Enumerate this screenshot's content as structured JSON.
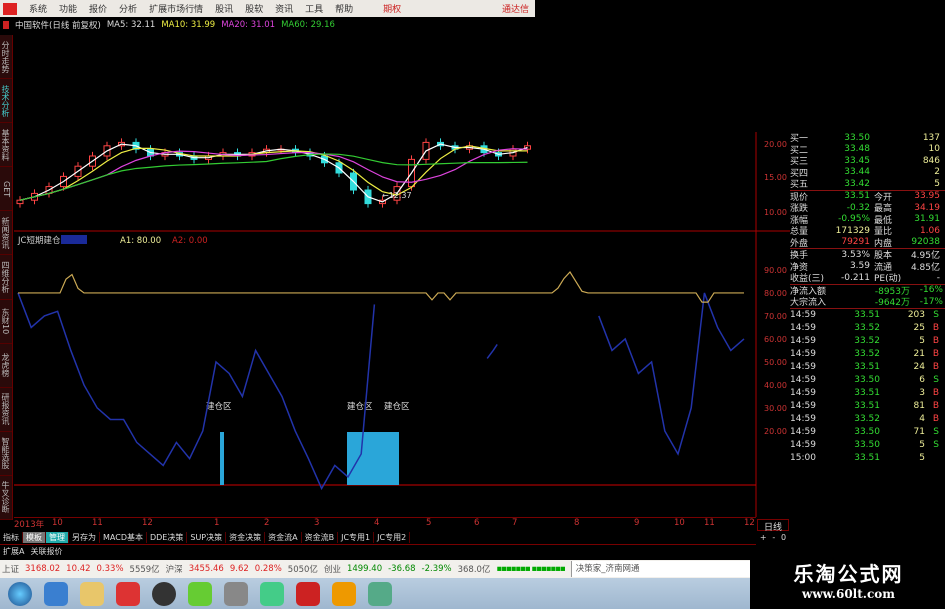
{
  "menu": {
    "items": [
      "系统",
      "功能",
      "报价",
      "分析",
      "扩展市场行情",
      "股讯",
      "股软",
      "资讯",
      "工具",
      "帮助"
    ],
    "option": "期权",
    "brand": "通达信"
  },
  "title": {
    "stock": "中国软件(日线 前复权)",
    "ma5": "MA5: 32.11",
    "ma10": "MA10: 31.99",
    "ma20": "MA20: 31.01",
    "ma60": "MA60: 29.16"
  },
  "left_tabs": [
    "分时走势",
    "技术分析",
    "基本资料",
    "GET",
    "新闻资讯",
    "四维分析",
    "东财10",
    "龙虎榜",
    "研报资讯",
    "智能选股",
    "牛叉诊断"
  ],
  "indicator": {
    "name": "JC短期建仓",
    "a1": "A1: 80.00",
    "a2": "A2: 0.00",
    "zone_label": "建仓区",
    "low_label": "←12.37"
  },
  "axes": {
    "price_ticks": [
      "20.00",
      "15.00",
      "10.00"
    ],
    "ind_ticks": [
      "90.00",
      "80.00",
      "70.00",
      "60.00",
      "50.00",
      "40.00",
      "30.00",
      "20.00"
    ],
    "x_ticks": [
      "2013年",
      "10",
      "11",
      "12",
      "1",
      "2",
      "3",
      "4",
      "5",
      "6",
      "7",
      "8",
      "9",
      "10",
      "11",
      "12"
    ]
  },
  "chart_data": {
    "type": "candlestick",
    "closes": [
      14,
      16,
      18,
      21,
      24,
      27,
      30,
      31,
      29,
      27,
      28,
      27,
      26,
      27,
      28,
      27,
      28,
      29,
      29,
      28,
      27,
      25,
      22,
      17,
      13,
      14,
      18,
      26,
      31,
      30,
      29,
      30,
      28,
      27,
      29,
      30
    ],
    "indicator_line": [
      80,
      65,
      70,
      72,
      55,
      40,
      30,
      25,
      25,
      15,
      10,
      5,
      15,
      8,
      20,
      50,
      45,
      35,
      55,
      45,
      35,
      20,
      8,
      -5,
      5,
      0,
      10,
      75,
      null,
      null,
      null,
      null,
      null,
      null,
      null,
      null,
      55,
      null,
      null,
      null,
      null,
      null,
      null,
      null,
      70,
      55,
      60,
      45,
      50,
      20,
      10,
      30,
      80,
      65,
      55,
      60
    ],
    "signal_line": 80,
    "colors": {
      "up": "#ff4444",
      "down": "#33dddd",
      "ma5": "#ffffff",
      "ma10": "#eeee44",
      "ma20": "#dd44dd",
      "ma60": "#33cc33",
      "indicator": "#2233aa",
      "signal": "#ccaa55",
      "zone": "#2aa6d9"
    }
  },
  "quotes": {
    "bids": [
      [
        "买一",
        "33.50",
        "137"
      ],
      [
        "买二",
        "33.48",
        "10"
      ],
      [
        "买三",
        "33.45",
        "846"
      ],
      [
        "买四",
        "33.44",
        "2"
      ],
      [
        "买五",
        "33.42",
        "5"
      ]
    ],
    "stats": [
      [
        "现价",
        "33.51",
        "今开",
        "33.95"
      ],
      [
        "涨跌",
        "-0.32",
        "最高",
        "34.19"
      ],
      [
        "涨幅",
        "-0.95%",
        "最低",
        "31.91"
      ],
      [
        "总量",
        "171329",
        "量比",
        "1.06"
      ],
      [
        "外盘",
        "79291",
        "内盘",
        "92038"
      ]
    ],
    "stats2": [
      [
        "换手",
        "3.53%",
        "股本",
        "4.95亿"
      ],
      [
        "净资",
        "3.59",
        "流通",
        "4.85亿"
      ],
      [
        "收益(三)",
        "-0.211",
        "PE(动)",
        "-"
      ]
    ],
    "flows": [
      [
        "净流入额",
        "-8953万",
        "-16%"
      ],
      [
        "大宗流入",
        "-9642万",
        "-17%"
      ]
    ],
    "ticks": [
      [
        "14:59",
        "33.51",
        "203",
        "S"
      ],
      [
        "14:59",
        "33.52",
        "25",
        "B"
      ],
      [
        "14:59",
        "33.52",
        "5",
        "B"
      ],
      [
        "14:59",
        "33.52",
        "21",
        "B"
      ],
      [
        "14:59",
        "33.51",
        "24",
        "B"
      ],
      [
        "14:59",
        "33.50",
        "6",
        "S"
      ],
      [
        "14:59",
        "33.51",
        "3",
        "B"
      ],
      [
        "14:59",
        "33.51",
        "81",
        "B"
      ],
      [
        "14:59",
        "33.52",
        "4",
        "B"
      ],
      [
        "14:59",
        "33.50",
        "71",
        "S"
      ],
      [
        "14:59",
        "33.50",
        "5",
        "S"
      ],
      [
        "15:00",
        "33.51",
        "5",
        ""
      ]
    ]
  },
  "bottom": {
    "day_unit": "日线",
    "zoom": [
      "+",
      "-",
      "0"
    ],
    "tabs": [
      "指标",
      "模板",
      "管理",
      "另存为",
      "MACD基本",
      "DDE决策",
      "SUP决策",
      "资金决策",
      "资金流A",
      "资金流B",
      "JC专用1",
      "JC专用2"
    ],
    "ext": [
      "扩展A",
      "关联报价"
    ]
  },
  "status": {
    "sh_label": "上证",
    "sh": "3168.02",
    "sh_chg": "10.42",
    "sh_pct": "0.33%",
    "sh_amt": "5559亿",
    "hs_label": "沪深",
    "hs": "3455.46",
    "hs_chg": "9.62",
    "hs_pct": "0.28%",
    "hs_amt": "5050亿",
    "cy_label": "创业",
    "cy": "1499.40",
    "cy_chg": "-36.68",
    "cy_pct": "-2.39%",
    "cy_amt": "368.0亿",
    "news": "决策家_济南网通"
  },
  "watermark": {
    "title": "乐淘公式网",
    "url": "www.60lt.com"
  }
}
